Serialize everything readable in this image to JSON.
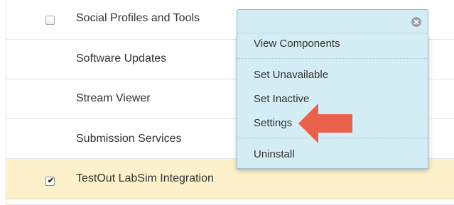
{
  "rows": [
    {
      "label": "Social Profiles and Tools",
      "checkbox": "unchecked"
    },
    {
      "label": "Software Updates"
    },
    {
      "label": "Stream Viewer"
    },
    {
      "label": "Submission Services"
    },
    {
      "label": "TestOut LabSim Integration",
      "checkbox": "checked"
    }
  ],
  "dropdown": {
    "clear_icon": "clear-icon",
    "items": [
      {
        "label": "View Components"
      },
      {
        "label": "Set Unavailable"
      },
      {
        "label": "Set Inactive"
      },
      {
        "label": "Settings"
      },
      {
        "label": "Uninstall"
      }
    ]
  },
  "annotation": {
    "arrow_color": "#e8614a",
    "points_to": "Settings"
  },
  "colors": {
    "selected_row": "#fdf1cc",
    "menu_background": "#d4ecf3"
  }
}
